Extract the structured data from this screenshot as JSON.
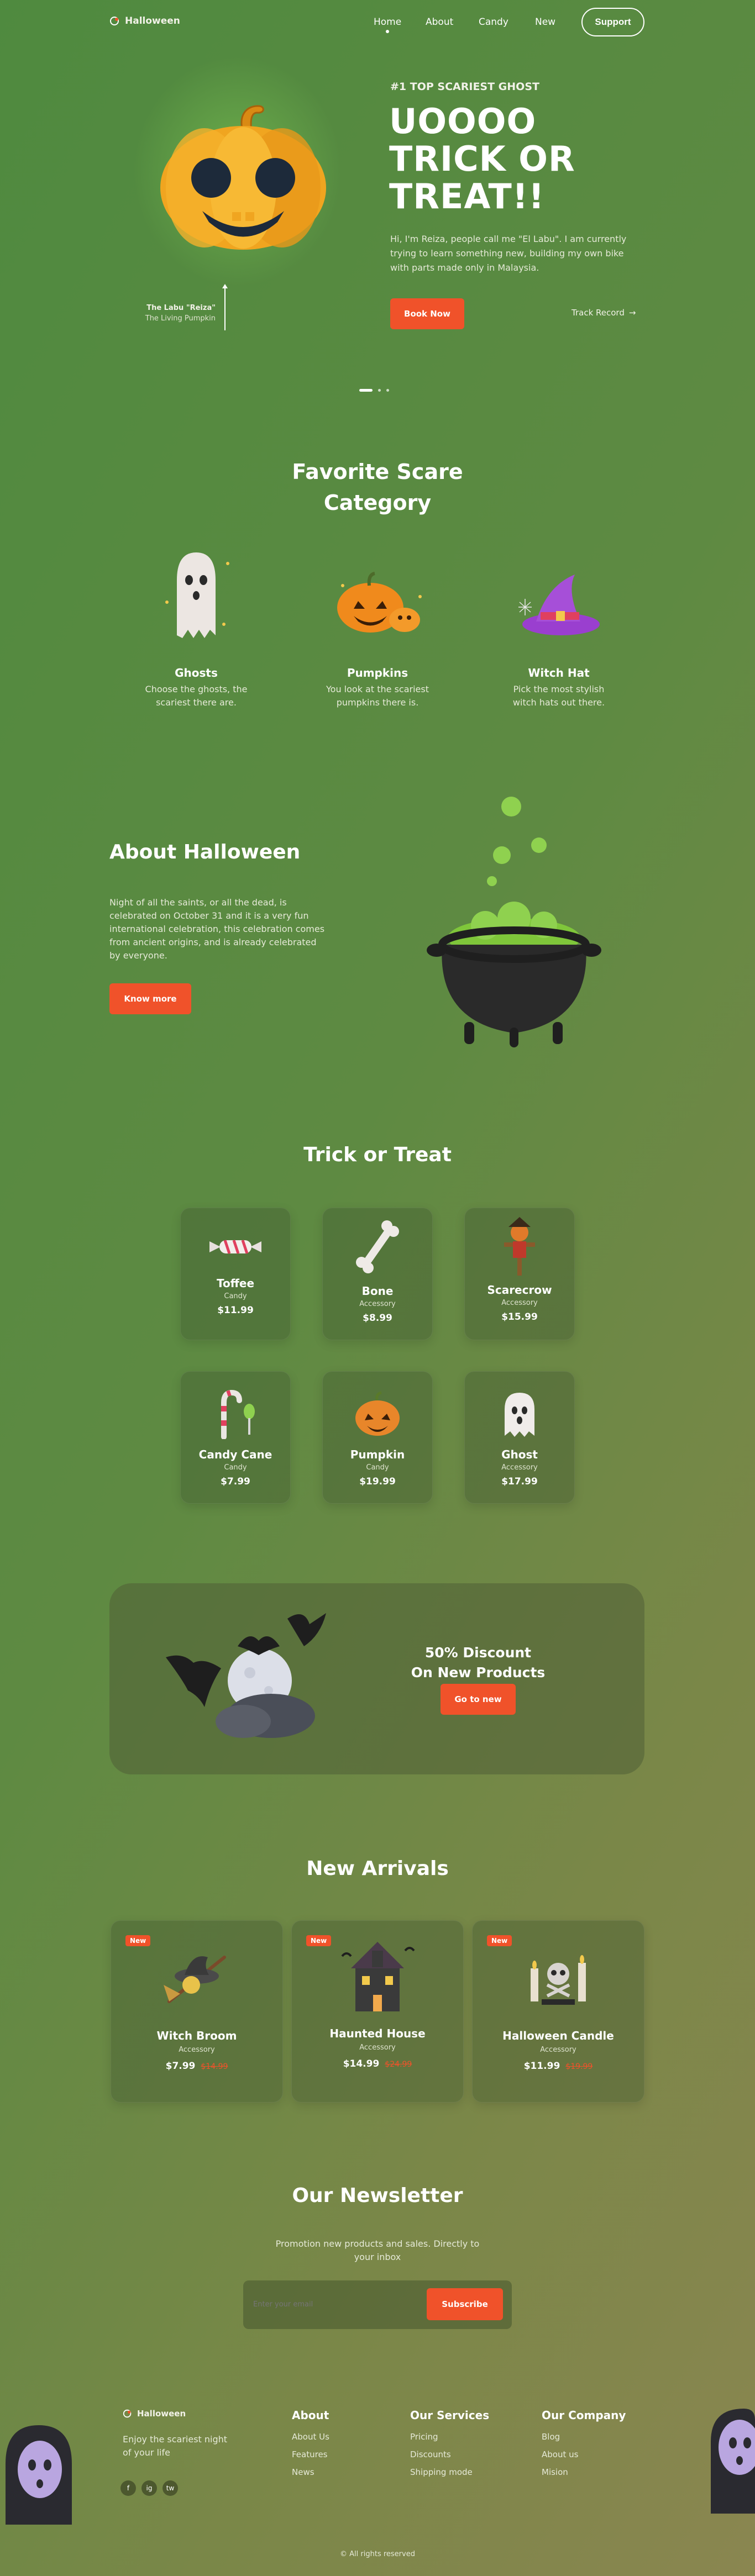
{
  "nav": {
    "logo_text": "Halloween",
    "links": [
      {
        "label": "Home",
        "active": true
      },
      {
        "label": "About",
        "active": false
      },
      {
        "label": "Candy",
        "active": false
      },
      {
        "label": "New",
        "active": false
      }
    ],
    "support_label": "Support"
  },
  "hero": {
    "tagline": "#1 TOP SCARIEST GHOST",
    "title_lines": [
      "UOOOO",
      "TRICK OR",
      "TREAT!!"
    ],
    "description": "Hi, I'm Reiza, people call me \"El Labu\". I am currently trying to learn something new, building my own bike with parts made only in Malaysia.",
    "cta_label": "Book Now",
    "secondary_label": "Track Record",
    "caption_name": "The Labu \"Reiza\"",
    "caption_sub": "The Living Pumpkin"
  },
  "categories": {
    "title_lines": [
      "Favorite Scare",
      "Category"
    ],
    "items": [
      {
        "name": "Ghosts",
        "desc_lines": [
          "Choose the ghosts, the",
          "scariest there are."
        ]
      },
      {
        "name": "Pumpkins",
        "desc_lines": [
          "You look at the scariest",
          "pumpkins there is."
        ]
      },
      {
        "name": "Witch Hat",
        "desc_lines": [
          "Pick the most stylish",
          "witch hats out there."
        ]
      }
    ]
  },
  "about": {
    "title": "About Halloween",
    "desc_lines": [
      "Night of all the saints, or all the dead, is",
      "celebrated on October 31 and it is a very fun",
      "international celebration, this celebration comes",
      "from ancient origins, and is already celebrated",
      "by everyone."
    ],
    "button_label": "Know more"
  },
  "trick": {
    "title": "Trick or Treat",
    "items": [
      {
        "name": "Toffee",
        "category": "Candy",
        "price": "$11.99"
      },
      {
        "name": "Bone",
        "category": "Accessory",
        "price": "$8.99"
      },
      {
        "name": "Scarecrow",
        "category": "Accessory",
        "price": "$15.99"
      },
      {
        "name": "Candy Cane",
        "category": "Candy",
        "price": "$7.99"
      },
      {
        "name": "Pumpkin",
        "category": "Candy",
        "price": "$19.99"
      },
      {
        "name": "Ghost",
        "category": "Accessory",
        "price": "$17.99"
      }
    ]
  },
  "promo": {
    "title_lines": [
      "50% Discount",
      "On New Products"
    ],
    "button_label": "Go to new"
  },
  "arrivals": {
    "title": "New Arrivals",
    "badge": "New",
    "items": [
      {
        "name": "Witch Broom",
        "category": "Accessory",
        "price": "$7.99",
        "old_price": "$14.99"
      },
      {
        "name": "Haunted House",
        "category": "Accessory",
        "price": "$14.99",
        "old_price": "$24.99"
      },
      {
        "name": "Halloween Candle",
        "category": "Accessory",
        "price": "$11.99",
        "old_price": "$19.99"
      }
    ]
  },
  "newsletter": {
    "title": "Our Newsletter",
    "desc_lines": [
      "Promotion new products and sales. Directly to",
      "your inbox"
    ],
    "placeholder": "Enter your email",
    "button_label": "Subscribe"
  },
  "footer": {
    "logo_text": "Halloween",
    "tagline_lines": [
      "Enjoy the scariest night",
      "of your life"
    ],
    "socials": [
      "f",
      "ig",
      "tw"
    ],
    "columns": [
      {
        "title": "About",
        "links": [
          "About Us",
          "Features",
          "News"
        ]
      },
      {
        "title": "Our Services",
        "links": [
          "Pricing",
          "Discounts",
          "Shipping mode"
        ]
      },
      {
        "title": "Our Company",
        "links": [
          "Blog",
          "About us",
          "Mision"
        ]
      }
    ],
    "copyright": "© All rights reserved"
  },
  "colors": {
    "accent": "#f0522a",
    "background_start": "#4f8a3f",
    "background_end": "#8a8650"
  },
  "slider": {
    "slides": 3,
    "active_slide": 1
  }
}
